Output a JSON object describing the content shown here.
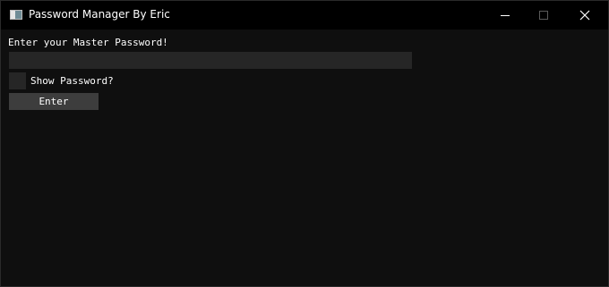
{
  "window": {
    "title": "Password Manager By Eric",
    "controls": [
      "minimize",
      "maximize",
      "close"
    ]
  },
  "form": {
    "prompt": "Enter your Master Password!",
    "password_value": "",
    "show_password_label": "Show Password?",
    "show_password_checked": false,
    "enter_label": "Enter"
  },
  "colors": {
    "titlebar": "#000000",
    "background": "#0f0f0f",
    "field": "#262626",
    "button": "#3d3d3d",
    "text": "#ffffff"
  },
  "icons": {
    "app": "app-window-icon",
    "minimize": "minimize-icon",
    "maximize": "maximize-icon",
    "close": "close-icon"
  }
}
